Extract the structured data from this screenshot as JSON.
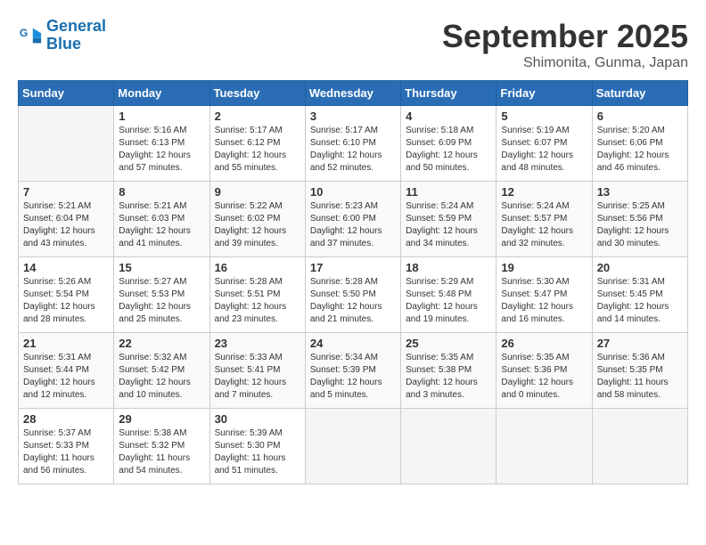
{
  "logo": {
    "line1": "General",
    "line2": "Blue"
  },
  "title": "September 2025",
  "location": "Shimonita, Gunma, Japan",
  "weekdays": [
    "Sunday",
    "Monday",
    "Tuesday",
    "Wednesday",
    "Thursday",
    "Friday",
    "Saturday"
  ],
  "weeks": [
    [
      {
        "day": null,
        "info": null
      },
      {
        "day": "1",
        "info": "Sunrise: 5:16 AM\nSunset: 6:13 PM\nDaylight: 12 hours\nand 57 minutes."
      },
      {
        "day": "2",
        "info": "Sunrise: 5:17 AM\nSunset: 6:12 PM\nDaylight: 12 hours\nand 55 minutes."
      },
      {
        "day": "3",
        "info": "Sunrise: 5:17 AM\nSunset: 6:10 PM\nDaylight: 12 hours\nand 52 minutes."
      },
      {
        "day": "4",
        "info": "Sunrise: 5:18 AM\nSunset: 6:09 PM\nDaylight: 12 hours\nand 50 minutes."
      },
      {
        "day": "5",
        "info": "Sunrise: 5:19 AM\nSunset: 6:07 PM\nDaylight: 12 hours\nand 48 minutes."
      },
      {
        "day": "6",
        "info": "Sunrise: 5:20 AM\nSunset: 6:06 PM\nDaylight: 12 hours\nand 46 minutes."
      }
    ],
    [
      {
        "day": "7",
        "info": "Sunrise: 5:21 AM\nSunset: 6:04 PM\nDaylight: 12 hours\nand 43 minutes."
      },
      {
        "day": "8",
        "info": "Sunrise: 5:21 AM\nSunset: 6:03 PM\nDaylight: 12 hours\nand 41 minutes."
      },
      {
        "day": "9",
        "info": "Sunrise: 5:22 AM\nSunset: 6:02 PM\nDaylight: 12 hours\nand 39 minutes."
      },
      {
        "day": "10",
        "info": "Sunrise: 5:23 AM\nSunset: 6:00 PM\nDaylight: 12 hours\nand 37 minutes."
      },
      {
        "day": "11",
        "info": "Sunrise: 5:24 AM\nSunset: 5:59 PM\nDaylight: 12 hours\nand 34 minutes."
      },
      {
        "day": "12",
        "info": "Sunrise: 5:24 AM\nSunset: 5:57 PM\nDaylight: 12 hours\nand 32 minutes."
      },
      {
        "day": "13",
        "info": "Sunrise: 5:25 AM\nSunset: 5:56 PM\nDaylight: 12 hours\nand 30 minutes."
      }
    ],
    [
      {
        "day": "14",
        "info": "Sunrise: 5:26 AM\nSunset: 5:54 PM\nDaylight: 12 hours\nand 28 minutes."
      },
      {
        "day": "15",
        "info": "Sunrise: 5:27 AM\nSunset: 5:53 PM\nDaylight: 12 hours\nand 25 minutes."
      },
      {
        "day": "16",
        "info": "Sunrise: 5:28 AM\nSunset: 5:51 PM\nDaylight: 12 hours\nand 23 minutes."
      },
      {
        "day": "17",
        "info": "Sunrise: 5:28 AM\nSunset: 5:50 PM\nDaylight: 12 hours\nand 21 minutes."
      },
      {
        "day": "18",
        "info": "Sunrise: 5:29 AM\nSunset: 5:48 PM\nDaylight: 12 hours\nand 19 minutes."
      },
      {
        "day": "19",
        "info": "Sunrise: 5:30 AM\nSunset: 5:47 PM\nDaylight: 12 hours\nand 16 minutes."
      },
      {
        "day": "20",
        "info": "Sunrise: 5:31 AM\nSunset: 5:45 PM\nDaylight: 12 hours\nand 14 minutes."
      }
    ],
    [
      {
        "day": "21",
        "info": "Sunrise: 5:31 AM\nSunset: 5:44 PM\nDaylight: 12 hours\nand 12 minutes."
      },
      {
        "day": "22",
        "info": "Sunrise: 5:32 AM\nSunset: 5:42 PM\nDaylight: 12 hours\nand 10 minutes."
      },
      {
        "day": "23",
        "info": "Sunrise: 5:33 AM\nSunset: 5:41 PM\nDaylight: 12 hours\nand 7 minutes."
      },
      {
        "day": "24",
        "info": "Sunrise: 5:34 AM\nSunset: 5:39 PM\nDaylight: 12 hours\nand 5 minutes."
      },
      {
        "day": "25",
        "info": "Sunrise: 5:35 AM\nSunset: 5:38 PM\nDaylight: 12 hours\nand 3 minutes."
      },
      {
        "day": "26",
        "info": "Sunrise: 5:35 AM\nSunset: 5:36 PM\nDaylight: 12 hours\nand 0 minutes."
      },
      {
        "day": "27",
        "info": "Sunrise: 5:36 AM\nSunset: 5:35 PM\nDaylight: 11 hours\nand 58 minutes."
      }
    ],
    [
      {
        "day": "28",
        "info": "Sunrise: 5:37 AM\nSunset: 5:33 PM\nDaylight: 11 hours\nand 56 minutes."
      },
      {
        "day": "29",
        "info": "Sunrise: 5:38 AM\nSunset: 5:32 PM\nDaylight: 11 hours\nand 54 minutes."
      },
      {
        "day": "30",
        "info": "Sunrise: 5:39 AM\nSunset: 5:30 PM\nDaylight: 11 hours\nand 51 minutes."
      },
      {
        "day": null,
        "info": null
      },
      {
        "day": null,
        "info": null
      },
      {
        "day": null,
        "info": null
      },
      {
        "day": null,
        "info": null
      }
    ]
  ]
}
